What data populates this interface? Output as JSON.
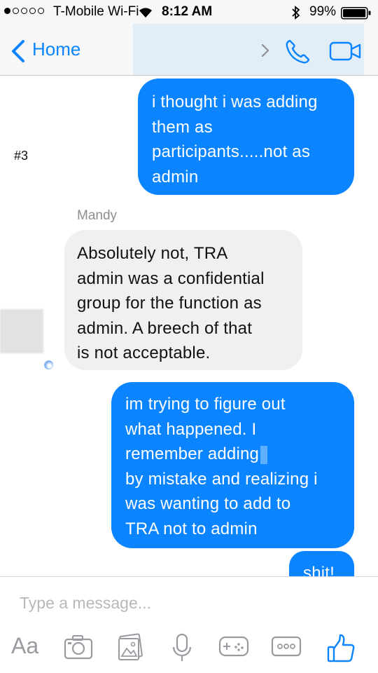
{
  "status_bar": {
    "signal_dots": [
      true,
      false,
      false,
      false,
      false
    ],
    "carrier": "T-Mobile Wi-Fi",
    "time": "8:12 AM",
    "battery_percent": "99%",
    "battery_level": 0.99
  },
  "nav": {
    "back_label": "Home",
    "accent_color": "#0a84ff",
    "icons": [
      "chevron-left-icon",
      "chevron-right-icon",
      "phone-icon",
      "video-camera-icon"
    ]
  },
  "side_note": "#3",
  "messages": [
    {
      "direction": "outgoing",
      "lines": [
        "i thought i was adding",
        "them as",
        "participants.....not as",
        "admin"
      ]
    },
    {
      "direction": "incoming",
      "sender": "Mandy",
      "lines": [
        "Absolutely not, TRA",
        "admin was a confidential",
        "group for the function as",
        "admin. A breech of that",
        "is not acceptable."
      ]
    },
    {
      "direction": "outgoing",
      "lines": [
        "im trying to figure out",
        "what happened. I",
        "remember adding",
        "by mistake and realizing i",
        "was wanting to add to",
        "TRA not to admin"
      ]
    },
    {
      "direction": "outgoing",
      "lines": [
        "shit!"
      ]
    }
  ],
  "composer": {
    "placeholder": "Type a message...",
    "aa_label": "Aa",
    "tools": [
      "camera-icon",
      "photo-icon",
      "microphone-icon",
      "game-controller-icon",
      "more-icon",
      "thumbs-up-icon"
    ]
  },
  "colors": {
    "outgoing_bubble": "#0a84ff",
    "incoming_bubble": "#f1f0f0",
    "bar_background": "#f7f7f7"
  }
}
